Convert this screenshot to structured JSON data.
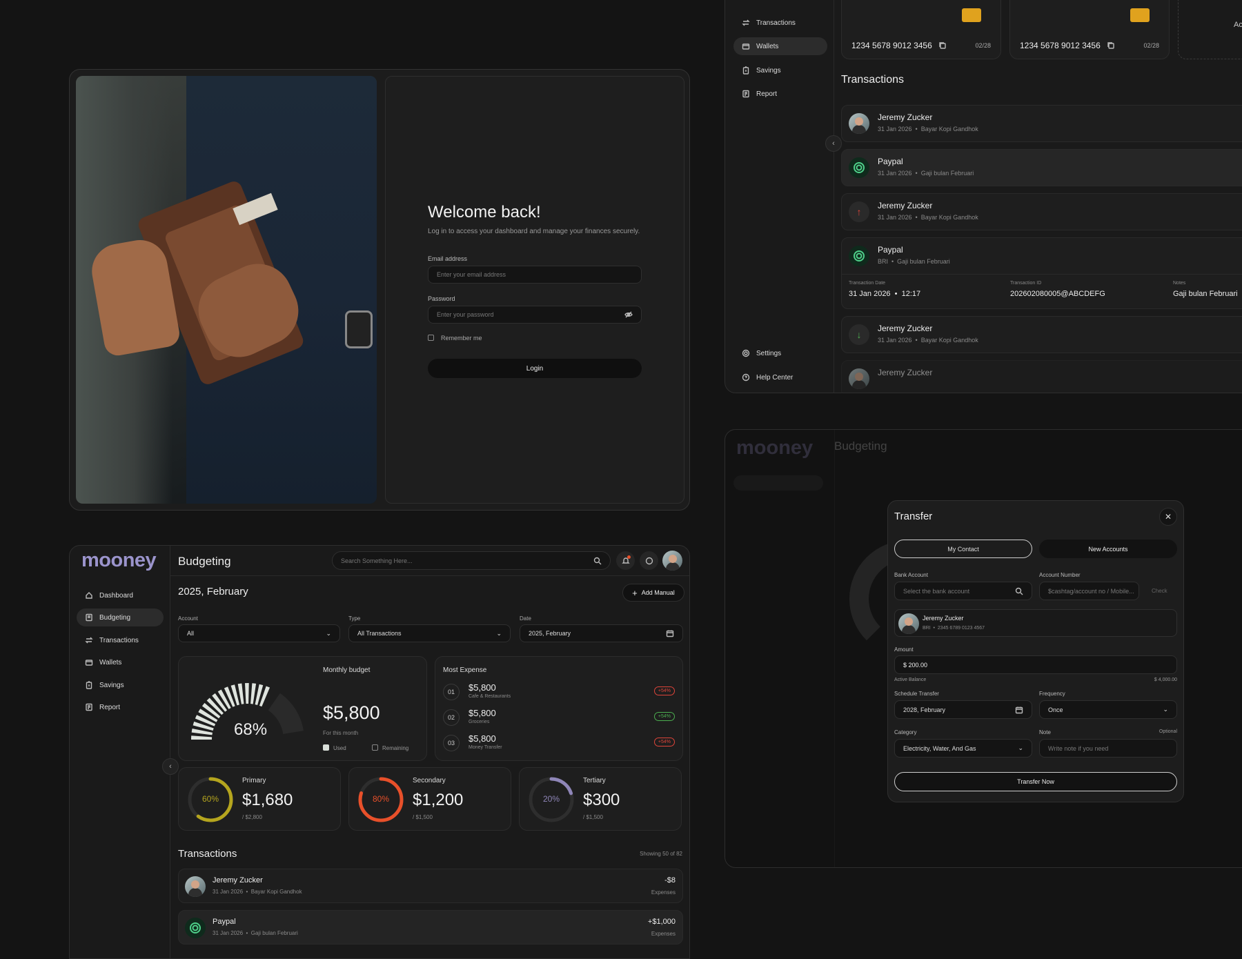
{
  "login": {
    "title": "Welcome back!",
    "subtitle": "Log in to access your dashboard and manage your finances securely.",
    "email_label": "Email address",
    "email_placeholder": "Enter your email address",
    "password_label": "Password",
    "password_placeholder": "Enter your password",
    "remember": "Remember me",
    "login_button": "Login"
  },
  "wallets_panel": {
    "nav": [
      "Transactions",
      "Wallets",
      "Savings",
      "Report"
    ],
    "nav_bottom": [
      "Settings",
      "Help Center"
    ],
    "active_nav": "Wallets",
    "cards": [
      {
        "number": "1234 5678 9012 3456",
        "expiry": "02/28"
      },
      {
        "number": "1234 5678 9012 3456",
        "expiry": "02/28"
      }
    ],
    "add_card_partial": "Ac",
    "transactions_title": "Transactions",
    "rows": [
      {
        "name": "Jeremy Zucker",
        "date": "31 Jan 2026",
        "note": "Bayar Kopi Gandhok",
        "icon": "avatar"
      },
      {
        "name": "Paypal",
        "date": "31 Jan 2026",
        "note": "Gaji bulan Februari",
        "icon": "paypal"
      },
      {
        "name": "Jeremy Zucker",
        "date": "31 Jan 2026",
        "note": "Bayar Kopi Gandhok",
        "icon": "arrow-up"
      },
      {
        "name": "Paypal",
        "date": "BRI",
        "note": "Gaji bulan Februari",
        "icon": "paypal"
      },
      {
        "name": "Jeremy Zucker",
        "date": "31 Jan 2026",
        "note": "Bayar Kopi Gandhok",
        "icon": "arrow-down"
      },
      {
        "name": "Jeremy Zucker",
        "date": "",
        "note": "",
        "icon": "avatar"
      }
    ],
    "detail": {
      "date_label": "Transaction Date",
      "date_value": "31 Jan 2026",
      "time_value": "12:17",
      "id_label": "Transaction ID",
      "id_value": "202602080005@ABCDEFG",
      "notes_label": "Notes",
      "notes_value": "Gaji bulan Februari"
    }
  },
  "budget": {
    "logo": "mooney",
    "title": "Budgeting",
    "search_placeholder": "Search Something Here...",
    "nav": [
      "Dashboard",
      "Budgeting",
      "Transactions",
      "Wallets",
      "Savings",
      "Report"
    ],
    "active_nav": "Budgeting",
    "period": "2025, February",
    "add_manual": "Add Manual",
    "filters": [
      {
        "label": "Account",
        "value": "All"
      },
      {
        "label": "Type",
        "value": "All Transactions"
      },
      {
        "label": "Date",
        "value": "2025, February"
      }
    ],
    "monthly": {
      "label": "Monthly budget",
      "percent_text": "68%",
      "percent": 0.68,
      "amount": "$5,800",
      "caption": "For this month",
      "legend_used": "Used",
      "legend_remaining": "Remaining"
    },
    "most_expense": {
      "title": "Most Expense",
      "items": [
        {
          "rank": "01",
          "amount": "$5,800",
          "category": "Cafe & Restaurants",
          "badge": "+54%",
          "color": "#e0453a"
        },
        {
          "rank": "02",
          "amount": "$5,800",
          "category": "Groceries",
          "badge": "+54%",
          "color": "#4caf50"
        },
        {
          "rank": "03",
          "amount": "$5,800",
          "category": "Money Transfer",
          "badge": "+54%",
          "color": "#e0453a"
        }
      ]
    },
    "tiers": [
      {
        "name": "Primary",
        "percent_text": "60%",
        "percent": 0.6,
        "amount": "$1,680",
        "total": "/ $2,800",
        "color": "#b5a51e"
      },
      {
        "name": "Secondary",
        "percent_text": "80%",
        "percent": 0.8,
        "amount": "$1,200",
        "total": "/ $1,500",
        "color": "#e8502a"
      },
      {
        "name": "Tertiary",
        "percent_text": "20%",
        "percent": 0.2,
        "amount": "$300",
        "total": "/ $1,500",
        "color": "#8f86b8"
      }
    ],
    "transactions_title": "Transactions",
    "showing": "Showing 50 of 82",
    "tx": [
      {
        "name": "Jeremy Zucker",
        "date": "31 Jan 2026",
        "note": "Bayar Kopi Gandhok",
        "amount": "-$8",
        "type": "Expenses"
      },
      {
        "name": "Paypal",
        "date": "31 Jan 2026",
        "note": "Gaji bulan Februari",
        "amount": "+$1,000",
        "type": "Expenses"
      }
    ]
  },
  "transfer": {
    "title": "Transfer",
    "tab_contact": "My Contact",
    "tab_new": "New Accounts",
    "bank_label": "Bank Account",
    "bank_placeholder": "Select the bank account",
    "account_label": "Account Number",
    "account_placeholder": "$cashtag/account no / Mobile...",
    "check": "Check",
    "contact_name": "Jeremy Zucker",
    "contact_bank": "BRI",
    "contact_number": "2345 6789 0123 4567",
    "amount_label": "Amount",
    "amount_value": "$ 200.00",
    "active_balance_label": "Active Balance",
    "active_balance": "$ 4,000.00",
    "schedule_label": "Schedule Transfer",
    "schedule_value": "2028, February",
    "frequency_label": "Frequency",
    "frequency_value": "Once",
    "category_label": "Category",
    "category_value": "Electricity, Water, And Gas",
    "note_label": "Note",
    "note_optional": "Optional",
    "note_placeholder": "Write note if you need",
    "submit": "Transfer Now"
  },
  "background_dim": {
    "logo": "mooney",
    "title": "Budgeting"
  }
}
